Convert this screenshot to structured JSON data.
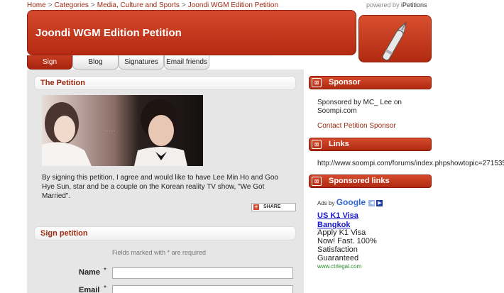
{
  "breadcrumb": [
    "Home",
    "Categories",
    "Media, Culture and Sports",
    "Joondi WGM Edition Petition"
  ],
  "breadcrumb_separator": ">",
  "powered": {
    "prefix": "powered by",
    "brand": "iPetitions"
  },
  "header": {
    "title": "Joondi WGM Edition Petition"
  },
  "tabs": [
    {
      "label": "Sign",
      "active": true
    },
    {
      "label": "Blog",
      "active": false
    },
    {
      "label": "Signatures",
      "active": false
    },
    {
      "label": "Email friends",
      "active": false
    }
  ],
  "petition": {
    "heading": "The Petition",
    "text": "By signing this petition, I agree and would like to have Lee Min Ho and Goo Hye Sun, star and be a couple on the Korean reality TV show, \"We Got Married\".",
    "share_label": "SHARE"
  },
  "sign": {
    "heading": "Sign petition",
    "fields_note": "Fields marked with * are required",
    "name_label": "Name",
    "email_label": "Email",
    "required_mark": "*"
  },
  "sidebar": {
    "sponsor_heading": "Sponsor",
    "sponsor_line1": "Sponsored by MC_ Lee on",
    "sponsor_line2": "Soompi.com",
    "contact_link": "Contact Petition Sponsor",
    "links_heading": "Links",
    "link_url": "http://www.soompi.com/forums/index.phpshowtopic=271535",
    "sponsored_links_heading": "Sponsored links",
    "close_glyph": "⊠"
  },
  "ads": {
    "ads_by": "Ads by",
    "google": "Google",
    "title_line1": "US K1 Visa",
    "title_line2": "Bangkok",
    "body": [
      "Apply K1 Visa",
      "Now! Fast. 100%",
      "Satisfaction",
      "Guaranteed"
    ],
    "url": "www.ctrlegal.com",
    "prev_arrow": "◀",
    "next_arrow": "▶"
  },
  "colors": {
    "brand_red": "#b52a12",
    "link_blue": "#1a1acc",
    "ad_green": "#2a8a2a"
  }
}
